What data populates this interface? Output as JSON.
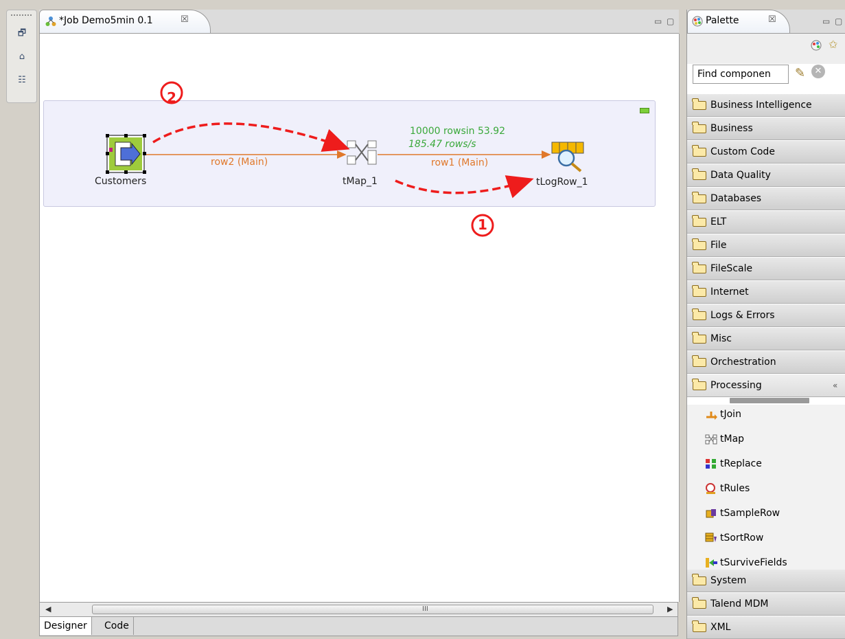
{
  "editor": {
    "tab_title": "*Job Demo5min 0.1",
    "close_glyph": "☒"
  },
  "diagram": {
    "nodes": {
      "source": "Customers",
      "map": "tMap_1",
      "log": "tLogRow_1"
    },
    "links": {
      "left": "row2 (Main)",
      "right": "row1 (Main)"
    },
    "stats": {
      "line1": "10000 rowsin 53.92",
      "line2": "185.47 rows/s"
    },
    "annotations": {
      "first": "1",
      "second": "2"
    },
    "annotation_color": "#ee1c1c",
    "link_color": "#e0782a",
    "stat_color": "#3aa83a"
  },
  "bottom_tabs": [
    "Designer",
    "Code"
  ],
  "scrollbar": {
    "grip": "III"
  },
  "palette": {
    "title": "Palette",
    "search_value": "Find componen",
    "drawers_top": [
      "Business Intelligence",
      "Business",
      "Custom Code",
      "Data Quality",
      "Databases",
      "ELT",
      "File",
      "FileScale",
      "Internet",
      "Logs & Errors",
      "Misc",
      "Orchestration",
      "Processing"
    ],
    "processing_components": [
      "tJoin",
      "tMap",
      "tReplace",
      "tRules",
      "tSampleRow",
      "tSortRow",
      "tSurviveFields"
    ],
    "drawers_bottom": [
      "System",
      "Talend MDM",
      "XML"
    ]
  }
}
